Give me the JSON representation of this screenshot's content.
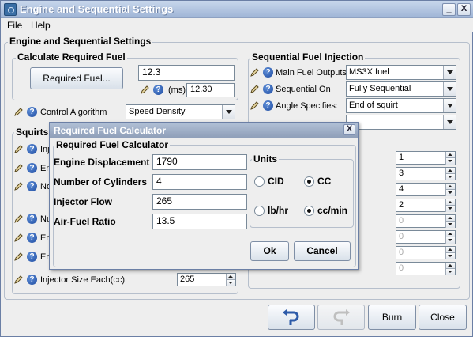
{
  "window": {
    "title": "Engine and Sequential Settings",
    "minimize": "_",
    "close": "X"
  },
  "menu": {
    "file": "File",
    "help": "Help"
  },
  "panel": {
    "title": "Engine and Sequential Settings"
  },
  "req_fuel": {
    "legend": "Calculate Required Fuel",
    "button": "Required Fuel...",
    "value": "12.3",
    "ms_label": "(ms)",
    "ms_value": "12.30"
  },
  "control": {
    "label": "Control Algorithm",
    "value": "Speed Density"
  },
  "squirts": {
    "legend": "Squirts",
    "rows": [
      "Inj",
      "En",
      "No",
      "Nu",
      "En",
      "En"
    ],
    "injector_label": "Injector Size Each(cc)",
    "injector_value": "265"
  },
  "seq": {
    "legend": "Sequential Fuel Injection",
    "rows": [
      {
        "label": "Main Fuel Outputs",
        "value": "MS3X fuel"
      },
      {
        "label": "Sequential On",
        "value": "Fully Sequential"
      },
      {
        "label": "Angle Specifies:",
        "value": "End of squirt"
      }
    ]
  },
  "right_spinners": [
    "1",
    "3",
    "4",
    "2",
    "0",
    "0",
    "0",
    "0"
  ],
  "dialog": {
    "title": "Required Fuel Calculator",
    "close": "X",
    "group": "Required Fuel Calculator",
    "fields": [
      {
        "label": "Engine Displacement",
        "value": "1790"
      },
      {
        "label": "Number of Cylinders",
        "value": "4"
      },
      {
        "label": "Injector Flow",
        "value": "265"
      },
      {
        "label": "Air-Fuel Ratio",
        "value": "13.5"
      }
    ],
    "units": {
      "legend": "Units",
      "cid": "CID",
      "cc": "CC",
      "lbhr": "lb/hr",
      "ccmin": "cc/min"
    },
    "ok": "Ok",
    "cancel": "Cancel"
  },
  "bottom": {
    "burn": "Burn",
    "close": "Close"
  },
  "icons": {
    "undo": "undo-arrow-icon",
    "redo": "redo-arrow-icon",
    "pencil": "pencil-icon",
    "help": "help-question-icon"
  }
}
